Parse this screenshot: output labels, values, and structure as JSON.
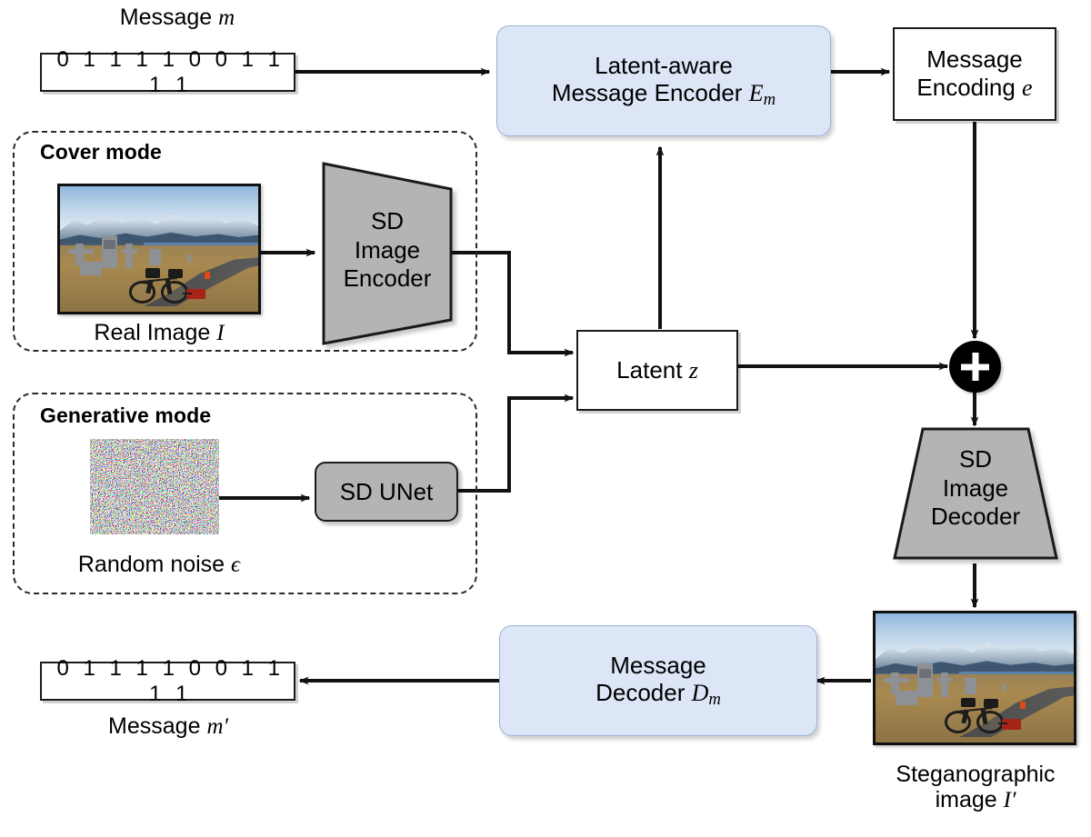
{
  "diagram": {
    "title": "Latent-aware steganography pipeline",
    "colors": {
      "blue_box": "#dce6f6",
      "gray_box": "#b4b4b4",
      "stroke": "#1a1a1a",
      "dashed_border": "#2b2b2b"
    }
  },
  "message_in": {
    "caption_prefix": "Message",
    "caption_symbol": "m",
    "bits": "0 1 1 1 1 0 0 1 1 1 1"
  },
  "message_out": {
    "caption_prefix": "Message",
    "caption_symbol": "m",
    "caption_prime": "′",
    "bits": "0 1 1 1 1 0 0 1 1 1 1"
  },
  "encoder_block": {
    "line1": "Latent-aware",
    "line2": "Message Encoder",
    "symbol": "E",
    "subscript": "m"
  },
  "decoder_block": {
    "line1": "Message",
    "line2": "Decoder",
    "symbol": "D",
    "subscript": "m"
  },
  "message_encoding": {
    "line1": "Message",
    "line2": "Encoding",
    "symbol": "e"
  },
  "cover_mode": {
    "title": "Cover mode",
    "image_caption_prefix": "Real Image",
    "image_caption_symbol": "I",
    "encoder": {
      "line1": "SD",
      "line2": "Image",
      "line3": "Encoder"
    }
  },
  "generative_mode": {
    "title": "Generative mode",
    "noise_caption_prefix": "Random noise",
    "noise_caption_symbol": "ϵ",
    "unet_label": "SD UNet"
  },
  "latent": {
    "label_prefix": "Latent",
    "label_symbol": "z"
  },
  "adder": {
    "symbol": "+"
  },
  "sd_decoder": {
    "line1": "SD",
    "line2": "Image",
    "line3": "Decoder"
  },
  "steg_image": {
    "caption_line1": "Steganographic",
    "caption_line2_prefix": "image",
    "caption_line2_symbol": "I",
    "caption_line2_prime": "′"
  }
}
